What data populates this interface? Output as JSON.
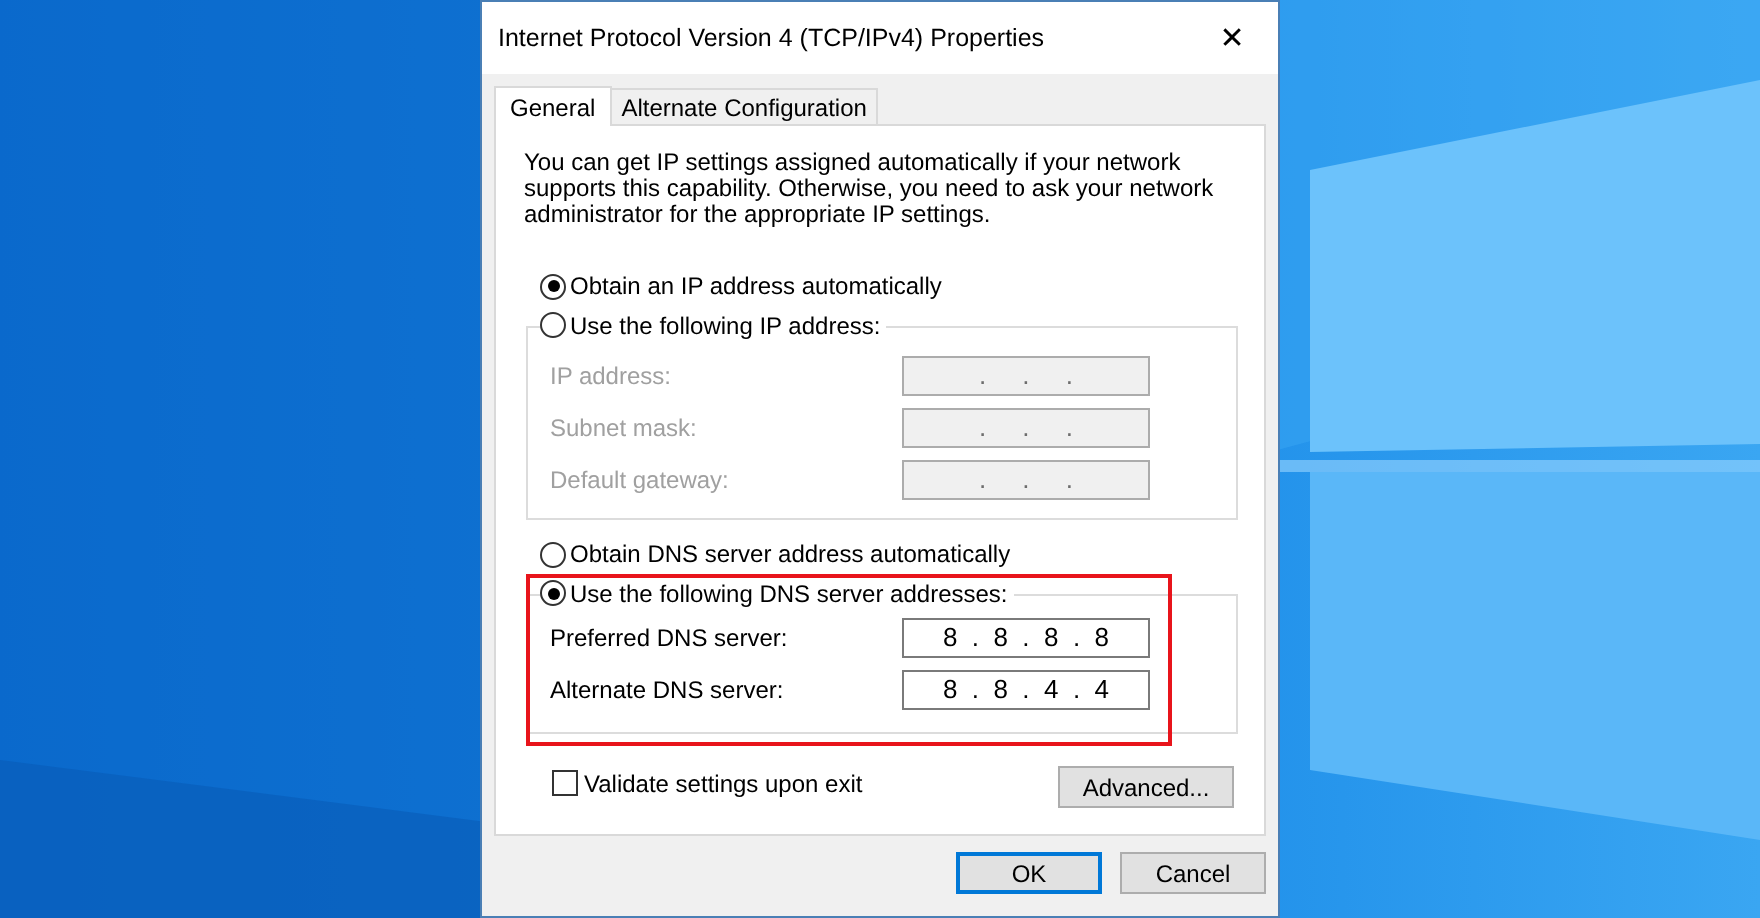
{
  "window": {
    "title": "Internet Protocol Version 4 (TCP/IPv4) Properties",
    "close": "✕"
  },
  "tabs": [
    {
      "label": "General",
      "selected": true
    },
    {
      "label": "Alternate Configuration",
      "selected": false
    }
  ],
  "intro": "You can get IP settings assigned automatically if your network supports this capability. Otherwise, you need to ask your network administrator for the appropriate IP settings.",
  "ip_auto": {
    "label": "Obtain an IP address automatically",
    "selected": true
  },
  "ip_manual": {
    "label": "Use the following IP address:",
    "selected": false,
    "fields": [
      {
        "label": "IP address:",
        "value": ".     .     .",
        "disabled": true
      },
      {
        "label": "Subnet mask:",
        "value": ".     .     .",
        "disabled": true
      },
      {
        "label": "Default gateway:",
        "value": ".     .     .",
        "disabled": true
      }
    ]
  },
  "dns_auto": {
    "label": "Obtain DNS server address automatically",
    "selected": false
  },
  "dns_manual": {
    "label": "Use the following DNS server addresses:",
    "selected": true,
    "fields": [
      {
        "label": "Preferred DNS server:",
        "value": "8  .  8  .  8  .  8",
        "disabled": false
      },
      {
        "label": "Alternate DNS server:",
        "value": "8  .  8  .  4  .  4",
        "disabled": false
      }
    ]
  },
  "validate": {
    "label": "Validate settings upon exit",
    "checked": false
  },
  "advanced_button": "Advanced...",
  "buttons": [
    {
      "label": "OK",
      "default": true
    },
    {
      "label": "Cancel",
      "default": false
    }
  ]
}
